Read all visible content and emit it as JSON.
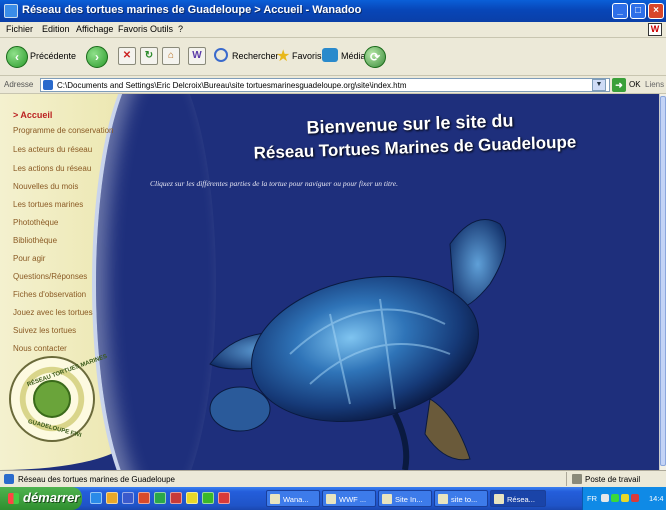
{
  "window": {
    "title": "Réseau des tortues marines de Guadeloupe > Accueil - Wanadoo",
    "controls": {
      "minimize": "_",
      "maximize": "□",
      "close": "×"
    }
  },
  "menu": [
    "Fichier",
    "Edition",
    "Affichage",
    "Favoris",
    "Outils",
    "?"
  ],
  "toolbar": {
    "back": "Précédente",
    "search": "Rechercher",
    "favorites": "Favoris",
    "media": "Média"
  },
  "address": {
    "label": "Adresse",
    "value": "C:\\Documents and Settings\\Eric Delcroix\\Bureau\\site tortuesmarinesguadeloupe.org\\site\\index.htm",
    "go": "OK",
    "links": "Liens"
  },
  "sidebar": {
    "items": [
      {
        "label": "> Accueil",
        "active": true
      },
      {
        "label": "Programme de conservation"
      },
      {
        "label": "Les acteurs du réseau"
      },
      {
        "label": "Les actions du réseau"
      },
      {
        "label": "Nouvelles du mois"
      },
      {
        "label": "Les tortues marines"
      },
      {
        "label": "Photothèque"
      },
      {
        "label": "Bibliothèque"
      },
      {
        "label": "Pour agir"
      },
      {
        "label": "Questions/Réponses"
      },
      {
        "label": "Fiches d'observation"
      },
      {
        "label": "Jouez avec les tortues"
      },
      {
        "label": "Suivez les tortues"
      },
      {
        "label": "Nous contacter"
      }
    ],
    "logo_text": {
      "top": "RÉSEAU TORTUES MARINES",
      "bottom": "GUADELOUPE FWI"
    }
  },
  "main": {
    "title_line1": "Bienvenue sur le site du",
    "title_line2": "Réseau Tortues Marines de Guadeloupe",
    "instruction": "Cliquez sur les différentes parties de la tortue pour naviguer ou pour fixer un titre."
  },
  "statusbar": {
    "text": "Réseau des tortues marines de Guadeloupe",
    "zone": "Poste de travail"
  },
  "taskbar": {
    "start": "démarrer",
    "tasks": [
      "Wana...",
      "WWF ...",
      "Site In...",
      "site to...",
      "Résea..."
    ],
    "lang": "FR",
    "clock": "14:4"
  },
  "colors": {
    "page_bg": "#1e2f7c",
    "sidebar_bg": "#f4f1cf",
    "nav_text": "#8a5a24",
    "active_nav": "#b22222"
  }
}
